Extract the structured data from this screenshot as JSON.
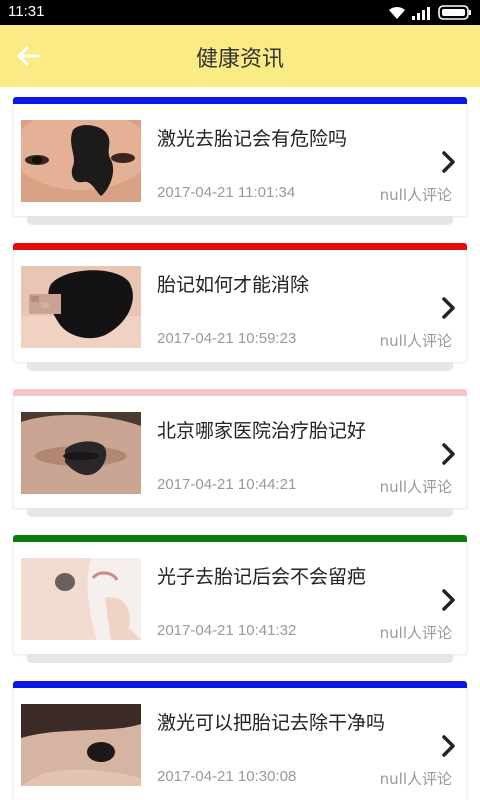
{
  "status_bar": {
    "time": "11:31"
  },
  "header": {
    "title": "健康资讯"
  },
  "icons": {
    "back": "arrow-left-icon",
    "chevron": "chevron-right-icon"
  },
  "colors": {
    "header_bg": "#fbeb84"
  },
  "news": [
    {
      "title": "激光去胎记会有危险吗",
      "time": "2017-04-21 11:01:34",
      "comments": "null人评论",
      "accent": "#0a17e6"
    },
    {
      "title": "胎记如何才能消除",
      "time": "2017-04-21 10:59:23",
      "comments": "null人评论",
      "accent": "#e60a0a"
    },
    {
      "title": "北京哪家医院治疗胎记好",
      "time": "2017-04-21 10:44:21",
      "comments": "null人评论",
      "accent": "#f6c5cc"
    },
    {
      "title": "光子去胎记后会不会留疤",
      "time": "2017-04-21 10:41:32",
      "comments": "null人评论",
      "accent": "#0a7d0a"
    },
    {
      "title": "激光可以把胎记去除干净吗",
      "time": "2017-04-21 10:30:08",
      "comments": "null人评论",
      "accent": "#0a17e6"
    }
  ]
}
